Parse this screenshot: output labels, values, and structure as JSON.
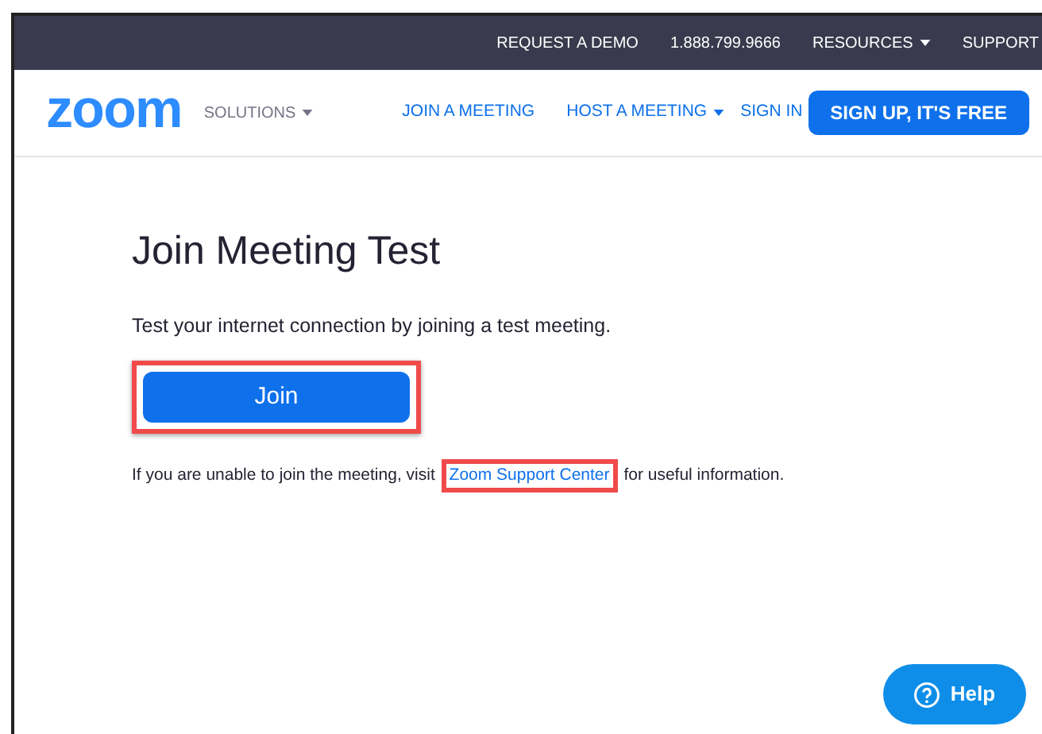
{
  "top_bar": {
    "links": [
      {
        "label": "REQUEST A DEMO",
        "dropdown": false
      },
      {
        "label": "1.888.799.9666",
        "dropdown": false
      },
      {
        "label": "RESOURCES",
        "dropdown": true
      },
      {
        "label": "SUPPORT",
        "dropdown": false
      }
    ]
  },
  "nav": {
    "logo": "zoom",
    "solutions": {
      "label": "SOLUTIONS",
      "dropdown": true
    },
    "links": [
      {
        "label": "JOIN A MEETING",
        "dropdown": false
      },
      {
        "label": "HOST A MEETING",
        "dropdown": true
      },
      {
        "label": "SIGN IN",
        "dropdown": false
      }
    ],
    "signup_button": "SIGN UP, IT'S FREE"
  },
  "main": {
    "title": "Join Meeting Test",
    "description": "Test your internet connection by joining a test meeting.",
    "join_button": {
      "label": "Join",
      "highlighted": true
    },
    "help_text": {
      "before": "If you are unable to join the meeting, visit",
      "link": "Zoom Support Center",
      "link_highlighted": true,
      "after": "for useful information."
    }
  },
  "help_button": "Help"
}
